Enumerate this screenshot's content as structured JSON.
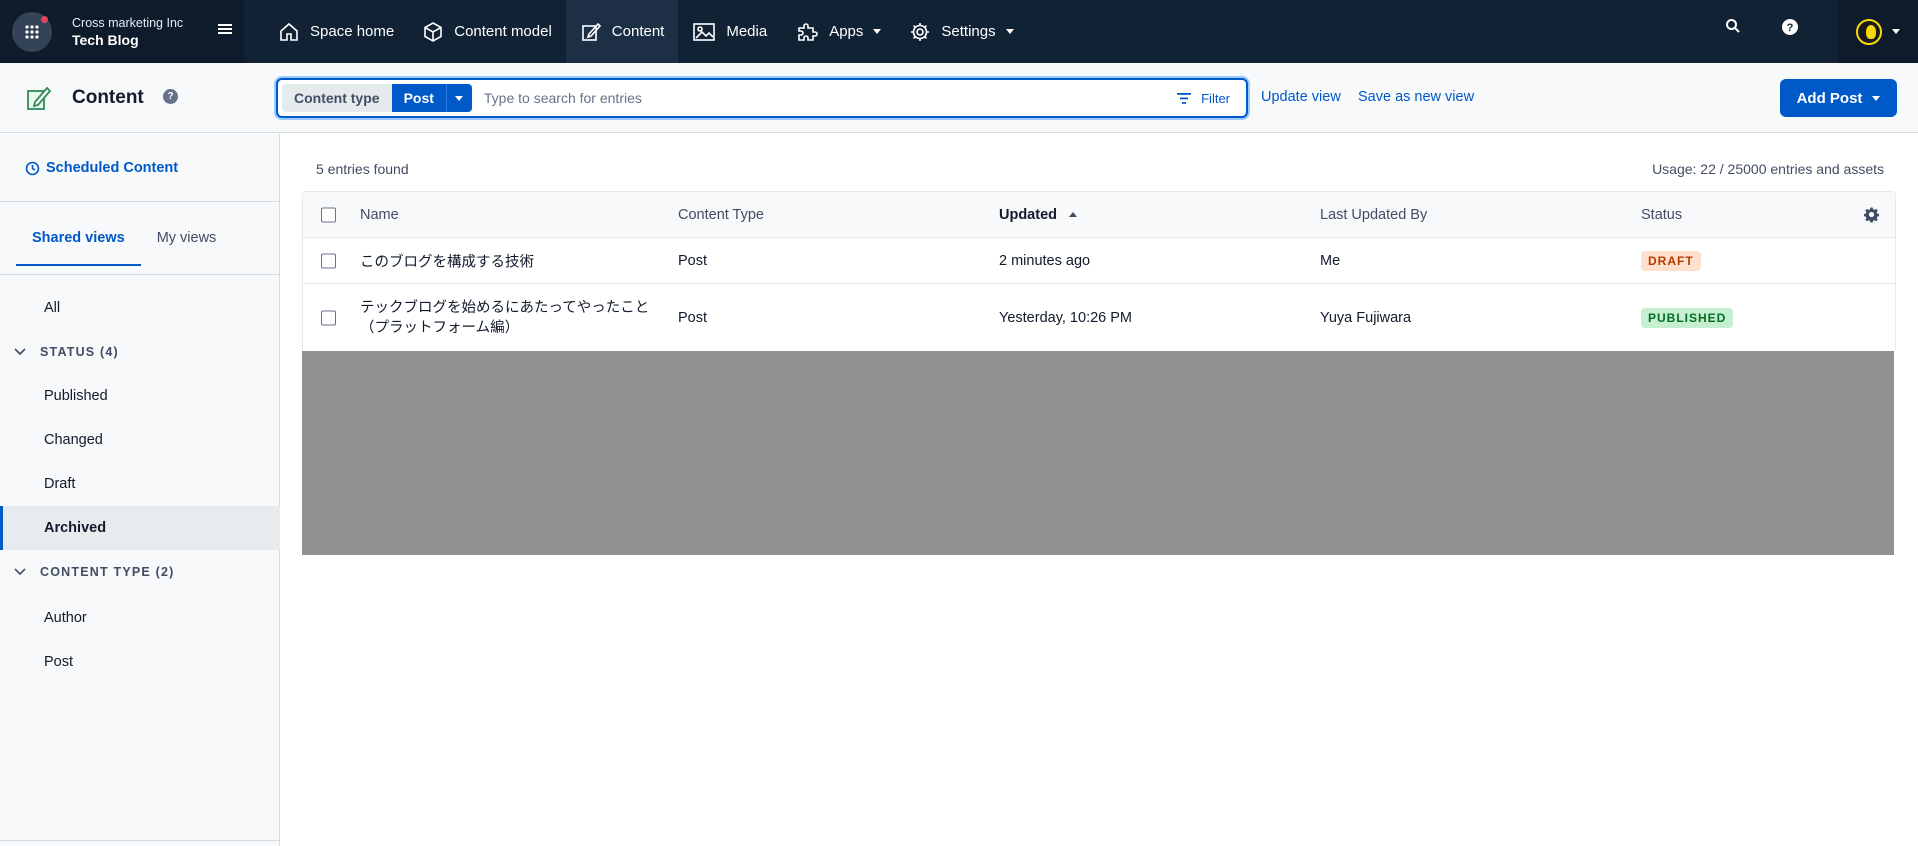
{
  "top_nav": {
    "org_name": "Cross marketing Inc",
    "space_name": "Tech Blog",
    "items": [
      {
        "label": "Space home",
        "icon": "home-icon"
      },
      {
        "label": "Content model",
        "icon": "cube-icon"
      },
      {
        "label": "Content",
        "icon": "edit-icon",
        "active": true
      },
      {
        "label": "Media",
        "icon": "image-icon"
      },
      {
        "label": "Apps",
        "icon": "puzzle-icon",
        "dropdown": true
      },
      {
        "label": "Settings",
        "icon": "gear-icon",
        "dropdown": true
      }
    ]
  },
  "header": {
    "title": "Content",
    "search": {
      "pill_label": "Content type",
      "pill_value": "Post",
      "placeholder": "Type to search for entries",
      "filter_label": "Filter"
    },
    "update_view": "Update view",
    "save_as_new_view": "Save as new view",
    "add_button": "Add Post"
  },
  "sidebar": {
    "scheduled": "Scheduled Content",
    "tabs": [
      "Shared views",
      "My views"
    ],
    "all": "All",
    "status_group": "STATUS (4)",
    "status_items": [
      "Published",
      "Changed",
      "Draft",
      "Archived"
    ],
    "content_type_group": "CONTENT TYPE (2)",
    "content_type_items": [
      "Author",
      "Post"
    ]
  },
  "main": {
    "entries_found": "5 entries found",
    "usage": "Usage: 22 / 25000 entries and assets",
    "columns": [
      "Name",
      "Content Type",
      "Updated",
      "Last Updated By",
      "Status"
    ],
    "rows": [
      {
        "name": "このブログを構成する技術",
        "content_type": "Post",
        "updated": "2 minutes ago",
        "updated_by": "Me",
        "status": "DRAFT"
      },
      {
        "name_line1": "テックブログを始めるにあたってやったこと",
        "name_line2": "（プラットフォーム編）",
        "content_type": "Post",
        "updated": "Yesterday, 10:26 PM",
        "updated_by": "Yuya Fujiwara",
        "status": "PUBLISHED"
      }
    ]
  },
  "colors": {
    "topbar": "#112235",
    "primary": "#0059c8",
    "draft_bg": "#fee1cc",
    "published_bg": "#c6efd1",
    "overlay": "#919191"
  }
}
